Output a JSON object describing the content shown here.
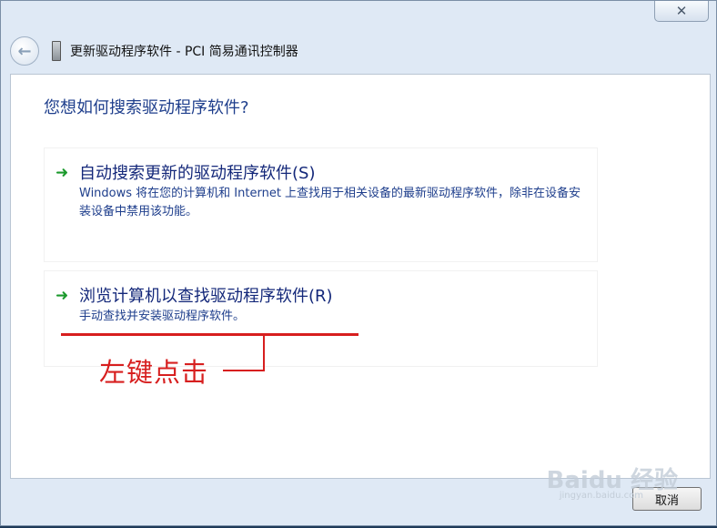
{
  "window": {
    "close_glyph": "✕",
    "back_glyph": "←",
    "title": "更新驱动程序软件 - PCI 简易通讯控制器"
  },
  "content": {
    "heading": "您想如何搜索驱动程序软件?",
    "options": [
      {
        "arrow": "➜",
        "title": "自动搜索更新的驱动程序软件(S)",
        "description": "Windows 将在您的计算机和 Internet 上查找用于相关设备的最新驱动程序软件，除非在设备安装设备中禁用该功能。"
      },
      {
        "arrow": "➜",
        "title": "浏览计算机以查找驱动程序软件(R)",
        "description": "手动查找并安装驱动程序软件。"
      }
    ],
    "annotation": "左键点击"
  },
  "footer": {
    "cancel_label": "取消"
  },
  "watermark": {
    "text": "Baidu 经验",
    "sub": "jingyan.baidu.com"
  },
  "colors": {
    "heading": "#1e3e8c",
    "option_title": "#14287a",
    "arrow": "#1b9a2c",
    "annotation": "#d71f1f"
  }
}
